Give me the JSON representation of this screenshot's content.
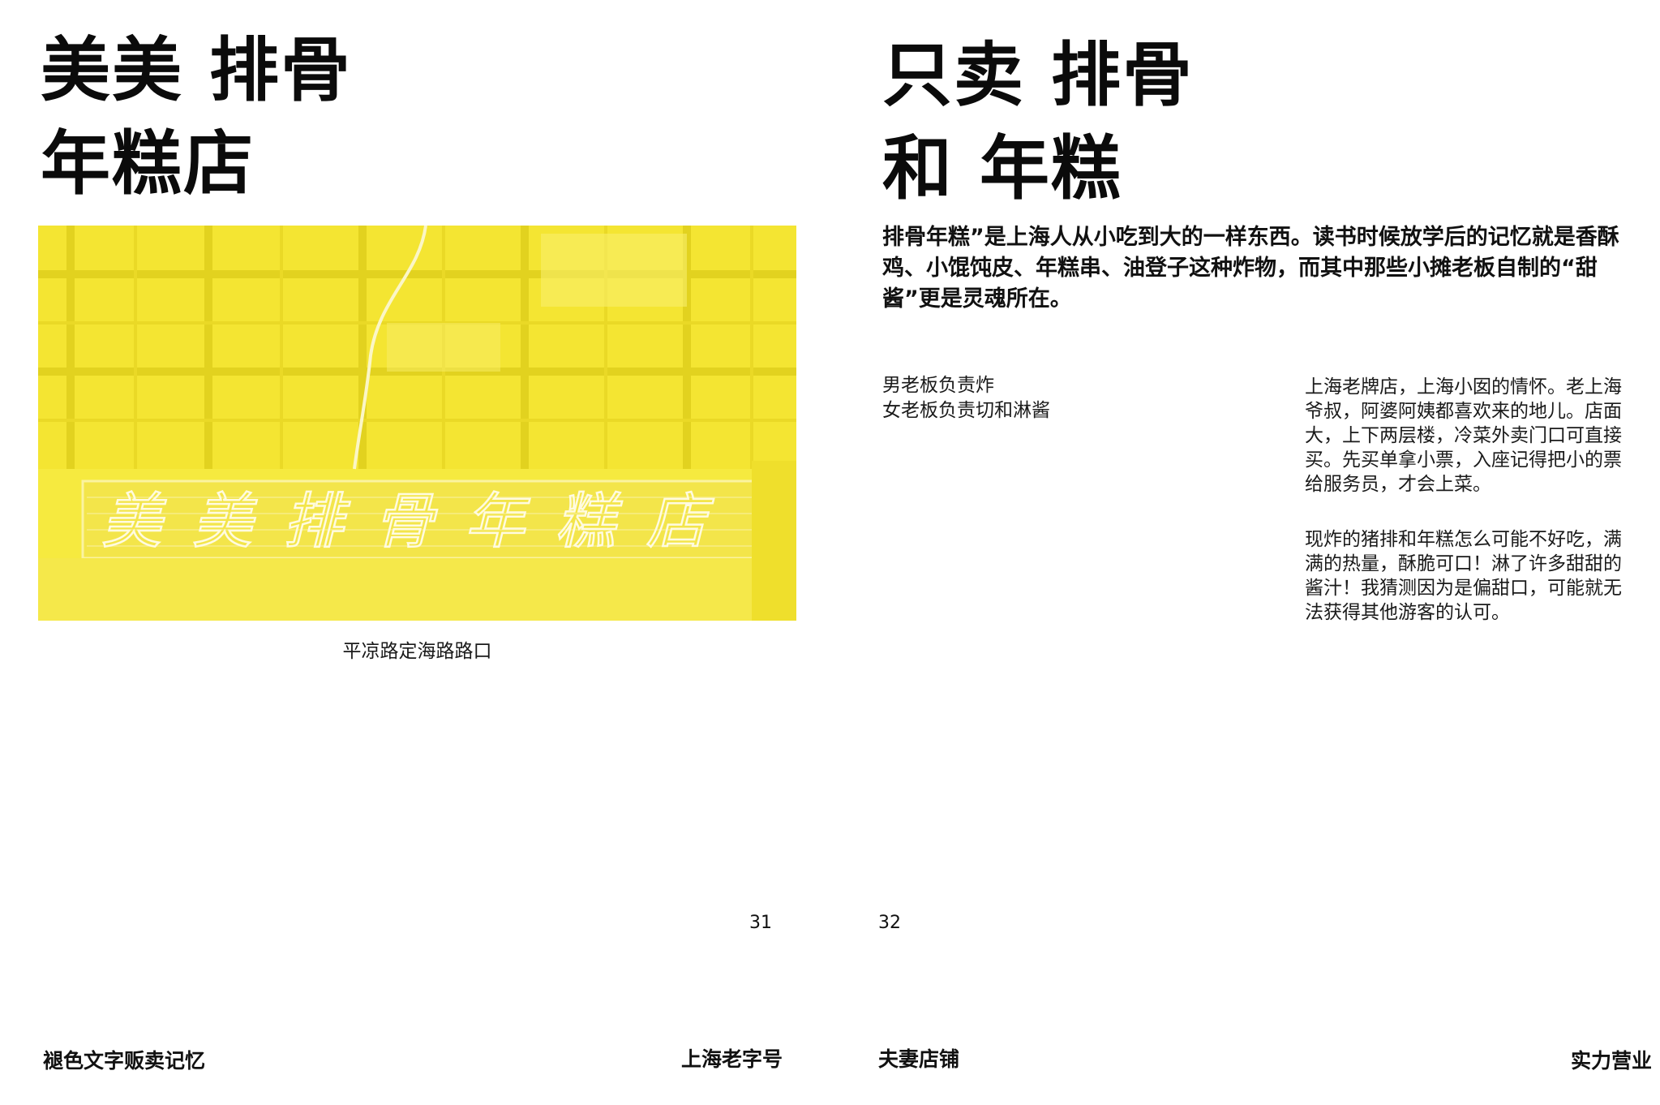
{
  "left_page": {
    "title_lines": [
      "美美 排骨",
      "年糕店"
    ],
    "photo": {
      "sign_text": "美美排骨年糕店",
      "tint_color": "#f6ea3f"
    },
    "caption": "平凉路定海路路口",
    "page_number": "31",
    "footer_left": "褪色文字贩卖记忆",
    "footer_right": "上海老字号"
  },
  "right_page": {
    "title_lines": [
      "只卖 排骨",
      "和 年糕"
    ],
    "lead": "排骨年糕”是上海人从小吃到大的一样东西。读书时候放学后的记忆就是香酥鸡、小馄饨皮、年糕串、油登子这种炸物，而其中那些小摊老板自制的“甜酱”更是灵魂所在。",
    "note_lines": [
      "男老板负责炸",
      "女老板负责切和淋酱"
    ],
    "paragraph_1": "上海老牌店，上海小囡的情怀。老上海爷叔，阿婆阿姨都喜欢来的地儿。店面大，上下两层楼，冷菜外卖门口可直接买。先买单拿小票，入座记得把小的票给服务员，才会上菜。",
    "paragraph_2": "现炸的猪排和年糕怎么可能不好吃，满满的热量，酥脆可口！淋了许多甜甜的酱汁！我猜测因为是偏甜口，可能就无法获得其他游客的认可。",
    "page_number": "32",
    "footer_left": "夫妻店铺",
    "footer_right": "实力营业"
  }
}
